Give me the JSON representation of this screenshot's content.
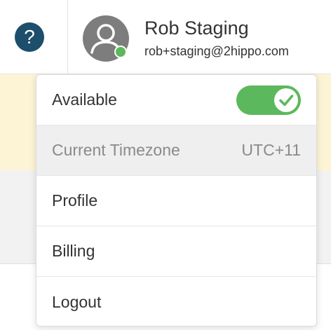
{
  "header": {
    "help_label": "?",
    "user_name": "Rob Staging",
    "user_email": "rob+staging@2hippo.com"
  },
  "menu": {
    "available_label": "Available",
    "available_on": true,
    "timezone_label": "Current Timezone",
    "timezone_value": "UTC+11",
    "profile_label": "Profile",
    "billing_label": "Billing",
    "logout_label": "Logout"
  },
  "icons": {
    "avatar": "user-avatar-icon",
    "status": "online-status-icon",
    "toggle_check": "check-icon"
  },
  "colors": {
    "help_bg": "#1d4e6b",
    "toggle_on": "#5cb85c",
    "status_online": "#5cb85c",
    "notice_bg": "#fdf4d6"
  }
}
